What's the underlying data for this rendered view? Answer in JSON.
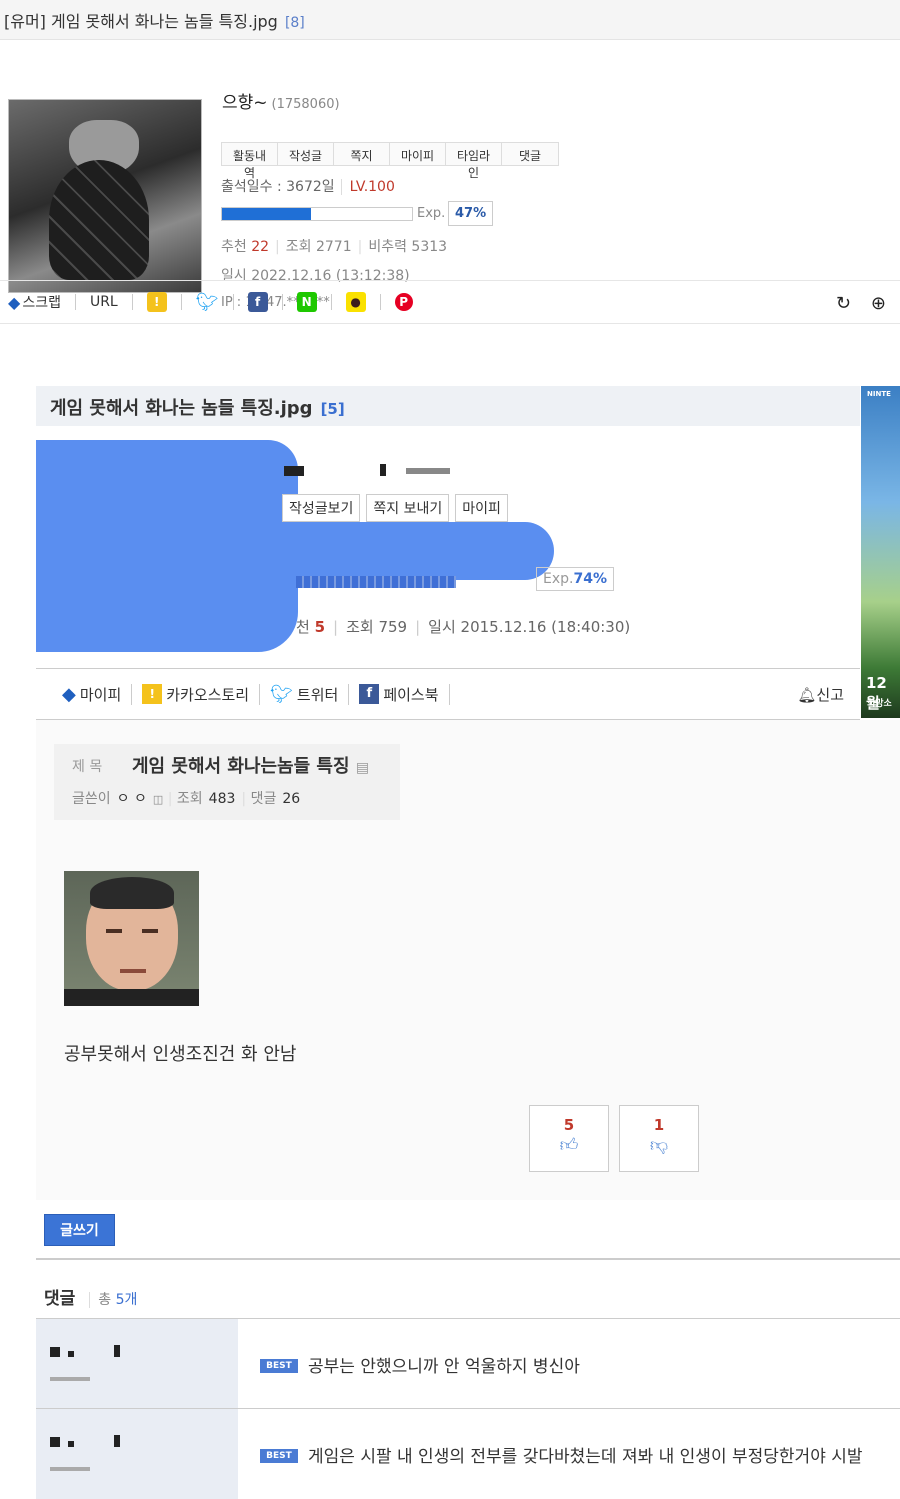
{
  "title": "[유머] 게임 못해서 화나는 놈들 특징.jpg",
  "title_count": "[8]",
  "author": {
    "nick": "으향~",
    "uid": "(1758060)"
  },
  "profile_tabs": [
    "활동내역",
    "작성글",
    "쪽지",
    "마이피",
    "타임라인",
    "댓글"
  ],
  "attendance": "출석일수 : 3672일",
  "level": "LV.100",
  "exp_label": "Exp.",
  "exp_pct": "47%",
  "exp_fraction": 0.47,
  "stats": {
    "rec_label": "추천",
    "rec": "22",
    "views": "조회 2771",
    "ratio": "비추력 5313"
  },
  "date": "일시 2022.12.16 (13:12:38)",
  "ip": "IP : 1.247.***.***",
  "share": {
    "scrap": "스크랩",
    "url": "URL"
  },
  "post": {
    "title": "게임 못해서 화나는 놈들 특징.jpg",
    "count": "[5]",
    "buttons": [
      "작성글보기",
      "쪽지 보내기",
      "마이피"
    ],
    "exp": "74%",
    "exp_label": "Exp.",
    "rec_tail": "천",
    "rec": "5",
    "views": "조회 759",
    "date": "일시 2015.12.16 (18:40:30)",
    "share": [
      "마이피",
      "카카오스토리",
      "트위터",
      "페이스북"
    ],
    "report": "신고"
  },
  "ad": {
    "brand": "NINTE",
    "date": "12월",
    "sub": "희망소"
  },
  "inner": {
    "label": "제 목",
    "title": "게임 못해서 화나는놈들 특징",
    "author_label": "글쓴이",
    "author": "ㅇ ㅇ",
    "views_label": "조회",
    "views": "483",
    "comments_label": "댓글",
    "comments": "26"
  },
  "content": "공부못해서 인생조진건 화 안남",
  "votes": {
    "up": "5",
    "down": "1"
  },
  "write_button": "글쓰기",
  "comments": {
    "heading": "댓글",
    "total_label": "총",
    "total": "5개",
    "items": [
      {
        "badge": "BEST",
        "text": "공부는 안했으니까 안 억울하지 병신아"
      },
      {
        "badge": "BEST",
        "text": "게임은 시팔 내 인생의 전부를 갖다바쳤는데 져봐 내 인생이 부정당한거야 시발"
      }
    ]
  }
}
